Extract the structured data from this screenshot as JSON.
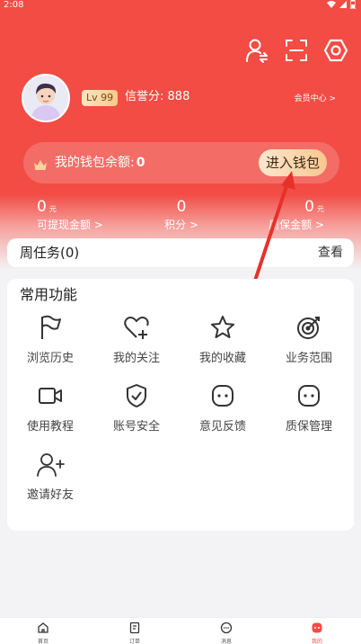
{
  "status_bar": {
    "time": "2:08"
  },
  "header": {
    "icons": [
      "user-switch-icon",
      "scan-icon",
      "settings-icon"
    ]
  },
  "profile": {
    "level": "Lv 99",
    "credit_label": "信誉分:",
    "credit_value": "888",
    "member_center": "会员中心 >"
  },
  "wallet": {
    "label": "我的钱包余额:",
    "amount": "0",
    "button": "进入钱包"
  },
  "stats": [
    {
      "value": "0",
      "unit": "元",
      "label": "可提现金额 >"
    },
    {
      "value": "0",
      "unit": "",
      "label": "积分 >"
    },
    {
      "value": "0",
      "unit": "元",
      "label": "质保金额 >"
    }
  ],
  "weekly": {
    "title": "周任务(0)",
    "action": "查看"
  },
  "functions": {
    "heading": "常用功能",
    "items": [
      {
        "label": "浏览历史",
        "icon": "flag-icon"
      },
      {
        "label": "我的关注",
        "icon": "heart-plus-icon"
      },
      {
        "label": "我的收藏",
        "icon": "star-icon"
      },
      {
        "label": "业务范围",
        "icon": "target-icon"
      },
      {
        "label": "使用教程",
        "icon": "video-icon"
      },
      {
        "label": "账号安全",
        "icon": "shield-icon"
      },
      {
        "label": "意见反馈",
        "icon": "feedback-icon"
      },
      {
        "label": "质保管理",
        "icon": "warranty-icon"
      },
      {
        "label": "邀请好友",
        "icon": "invite-user-icon"
      }
    ]
  },
  "tabbar": {
    "items": [
      {
        "label": "首页",
        "icon": "home-icon"
      },
      {
        "label": "订单",
        "icon": "order-icon"
      },
      {
        "label": "消息",
        "icon": "message-icon"
      },
      {
        "label": "我的",
        "icon": "me-icon"
      }
    ]
  },
  "colors": {
    "brand_red": "#f24c45",
    "gold_button": "#f8c790"
  }
}
